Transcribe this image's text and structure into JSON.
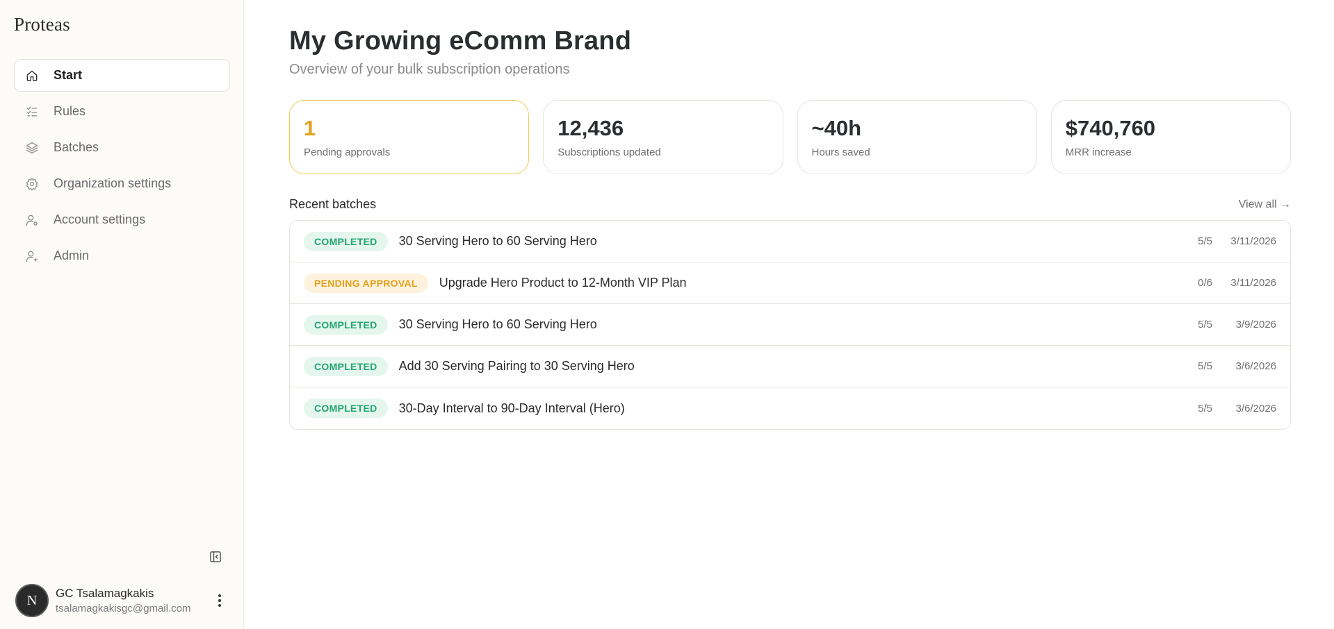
{
  "sidebar": {
    "brand": "Proteas",
    "items": [
      {
        "label": "Start",
        "icon": "home-icon",
        "active": true
      },
      {
        "label": "Rules",
        "icon": "checklist-icon"
      },
      {
        "label": "Batches",
        "icon": "layers-icon"
      },
      {
        "label": "Organization settings",
        "icon": "gear-icon"
      },
      {
        "label": "Account settings",
        "icon": "user-settings-icon"
      },
      {
        "label": "Admin",
        "icon": "user-admin-icon"
      }
    ],
    "user": {
      "initial": "N",
      "name": "GC Tsalamagkakis",
      "email": "tsalamagkakisgc@gmail.com"
    }
  },
  "header": {
    "title": "My Growing eComm Brand",
    "subtitle": "Overview of your bulk subscription operations"
  },
  "stats": [
    {
      "value": "1",
      "label": "Pending approvals"
    },
    {
      "value": "12,436",
      "label": "Subscriptions updated"
    },
    {
      "value": "~40h",
      "label": "Hours saved"
    },
    {
      "value": "$740,760",
      "label": "MRR increase"
    }
  ],
  "recent": {
    "title": "Recent batches",
    "view_all": "View all →",
    "rows": [
      {
        "status": "COMPLETED",
        "name": "30 Serving Hero to 60 Serving Hero",
        "count": "5/5",
        "date": "3/11/2026"
      },
      {
        "status": "PENDING APPROVAL",
        "name": "Upgrade Hero Product to 12-Month VIP Plan",
        "count": "0/6",
        "date": "3/11/2026"
      },
      {
        "status": "COMPLETED",
        "name": "30 Serving Hero to 60 Serving Hero",
        "count": "5/5",
        "date": "3/9/2026"
      },
      {
        "status": "COMPLETED",
        "name": "Add 30 Serving Pairing to 30 Serving Hero",
        "count": "5/5",
        "date": "3/6/2026"
      },
      {
        "status": "COMPLETED",
        "name": "30-Day Interval to 90-Day Interval (Hero)",
        "count": "5/5",
        "date": "3/6/2026"
      }
    ]
  },
  "colors": {
    "accent_highlight": "#efcb54",
    "completed": "#22a56f",
    "pending": "#e6a01e"
  }
}
